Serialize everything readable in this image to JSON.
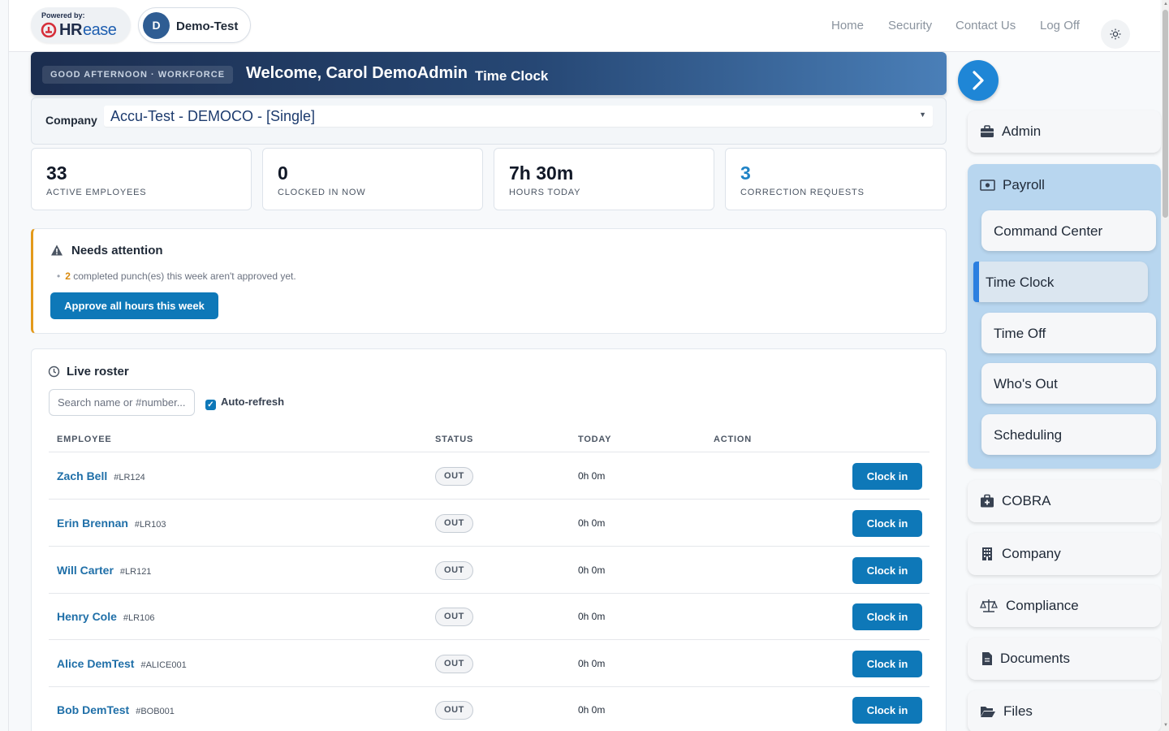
{
  "header": {
    "powered_by": "Powered by:",
    "logo_hr": "HR",
    "logo_ease": "ease",
    "company_initial": "D",
    "company_name": "Demo-Test",
    "nav": [
      "Home",
      "Security",
      "Contact Us",
      "Log Off"
    ],
    "theme_icon": "sun-icon"
  },
  "welcome": {
    "chip": "GOOD AFTERNOON · WORKFORCE",
    "greeting": "Welcome, Carol DemoAdmin",
    "module": "Time Clock"
  },
  "company_select": {
    "label": "Company",
    "value": "Accu-Test - DEMOCO - [Single]"
  },
  "stats": [
    {
      "value": "33",
      "label": "ACTIVE EMPLOYEES"
    },
    {
      "value": "0",
      "label": "CLOCKED IN NOW"
    },
    {
      "value": "7h 30m",
      "label": "HOURS TODAY"
    },
    {
      "value": "3",
      "label": "CORRECTION REQUESTS"
    }
  ],
  "attention": {
    "title": "Needs attention",
    "count": "2",
    "message": "completed punch(es) this week aren't approved yet.",
    "button": "Approve all hours this week"
  },
  "roster": {
    "title": "Live roster",
    "search_placeholder": "Search name or #number...",
    "auto_refresh": "Auto-refresh",
    "columns": [
      "EMPLOYEE",
      "STATUS",
      "TODAY",
      "ACTION"
    ],
    "rows": [
      {
        "name": "Zach Bell",
        "id": "#LR124",
        "status": "OUT",
        "today": "0h 0m",
        "action": "Clock in"
      },
      {
        "name": "Erin Brennan",
        "id": "#LR103",
        "status": "OUT",
        "today": "0h 0m",
        "action": "Clock in"
      },
      {
        "name": "Will Carter",
        "id": "#LR121",
        "status": "OUT",
        "today": "0h 0m",
        "action": "Clock in"
      },
      {
        "name": "Henry Cole",
        "id": "#LR106",
        "status": "OUT",
        "today": "0h 0m",
        "action": "Clock in"
      },
      {
        "name": "Alice DemTest",
        "id": "#ALICE001",
        "status": "OUT",
        "today": "0h 0m",
        "action": "Clock in"
      },
      {
        "name": "Bob DemTest",
        "id": "#BOB001",
        "status": "OUT",
        "today": "0h 0m",
        "action": "Clock in"
      }
    ]
  },
  "sidebar": {
    "admin": "Admin",
    "payroll": {
      "label": "Payroll",
      "items": [
        "Command Center",
        "Time Clock",
        "Time Off",
        "Who's Out",
        "Scheduling"
      ],
      "active": "Time Clock"
    },
    "others": [
      "COBRA",
      "Company",
      "Compliance",
      "Documents",
      "Files"
    ]
  },
  "colors": {
    "accent": "#0e78b8",
    "link": "#1f6fa8",
    "warning": "#e39a1b",
    "payroll_group": "#b8d6ef"
  }
}
